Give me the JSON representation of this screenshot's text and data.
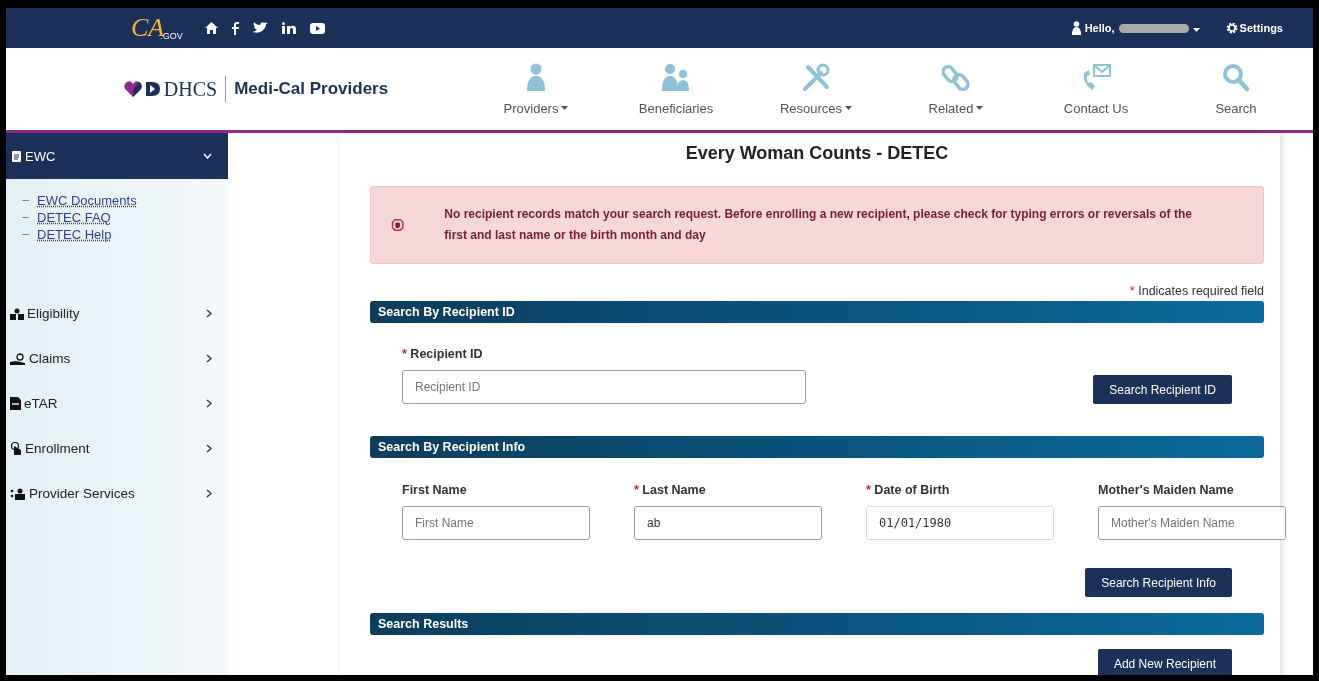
{
  "top_bar": {
    "logo_text": "CA",
    "logo_suffix": ".GOV",
    "greeting": "Hello,",
    "settings": "Settings"
  },
  "header": {
    "brand": "DHCS",
    "title": "Medi-Cal Providers",
    "nav": [
      {
        "label": "Providers",
        "dropdown": true
      },
      {
        "label": "Beneficiaries",
        "dropdown": false
      },
      {
        "label": "Resources",
        "dropdown": true
      },
      {
        "label": "Related",
        "dropdown": true
      },
      {
        "label": "Contact Us",
        "dropdown": false
      },
      {
        "label": "Search",
        "dropdown": false
      }
    ]
  },
  "sidebar": {
    "section": {
      "label": "EWC",
      "expanded": true,
      "links": [
        "EWC Documents",
        "DETEC FAQ",
        "DETEC Help"
      ]
    },
    "items": [
      {
        "label": "Eligibility",
        "expanded": false
      },
      {
        "label": "Claims",
        "expanded": false
      },
      {
        "label": "eTAR",
        "expanded": false
      },
      {
        "label": "Enrollment",
        "expanded": false
      },
      {
        "label": "Provider Services",
        "expanded": false
      }
    ]
  },
  "main": {
    "title": "Every Woman Counts - DETEC",
    "alert": "No recipient records match your search request. Before enrolling a new recipient, please check for typing errors or reversals of the first and last name or the birth month and day",
    "required_mark": "*",
    "required_note": "Indicates required field",
    "sections": [
      {
        "heading": "Search By Recipient ID",
        "fields": [
          {
            "label": "Recipient ID",
            "required": true,
            "kind": "text",
            "placeholder": "Recipient ID"
          }
        ],
        "button": "Search Recipient ID"
      },
      {
        "heading": "Search By Recipient Info",
        "fields": [
          {
            "label": "First Name",
            "required": false,
            "kind": "text",
            "placeholder": "First Name"
          },
          {
            "label": "Last Name",
            "required": true,
            "kind": "text",
            "value": "ab"
          },
          {
            "label": "Date of Birth",
            "required": true,
            "kind": "date",
            "value": "01/01/1980"
          },
          {
            "label": "Mother's Maiden Name",
            "required": false,
            "kind": "text",
            "placeholder": "Mother's Maiden Name"
          }
        ],
        "button": "Search Recipient Info"
      },
      {
        "heading": "Search Results",
        "button": "Add New Recipient"
      }
    ]
  }
}
